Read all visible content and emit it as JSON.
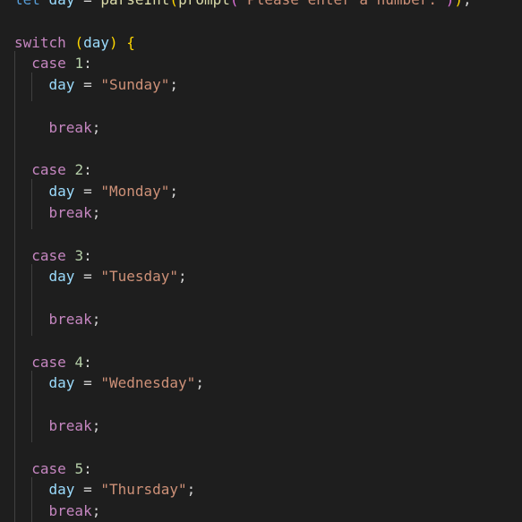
{
  "editor": {
    "lines": [
      {
        "tokens": [
          [
            "kw2",
            "let"
          ],
          [
            "pun",
            " "
          ],
          [
            "id",
            "day"
          ],
          [
            "pun",
            " = "
          ],
          [
            "fn",
            "parseInt"
          ],
          [
            "br1",
            "("
          ],
          [
            "fn",
            "prompt"
          ],
          [
            "br2",
            "("
          ],
          [
            "str",
            "\"Please enter a number:\""
          ],
          [
            "br2",
            ")"
          ],
          [
            "br1",
            ")"
          ],
          [
            "pun",
            ";"
          ]
        ]
      },
      {
        "tokens": []
      },
      {
        "tokens": [
          [
            "kw",
            "switch"
          ],
          [
            "pun",
            " "
          ],
          [
            "br1",
            "("
          ],
          [
            "id",
            "day"
          ],
          [
            "br1",
            ")"
          ],
          [
            "pun",
            " "
          ],
          [
            "br1",
            "{"
          ]
        ]
      },
      {
        "tokens": [
          [
            "pun",
            "  "
          ],
          [
            "kw",
            "case"
          ],
          [
            "pun",
            " "
          ],
          [
            "num",
            "1"
          ],
          [
            "pun",
            ":"
          ]
        ]
      },
      {
        "tokens": [
          [
            "pun",
            "    "
          ],
          [
            "id",
            "day"
          ],
          [
            "pun",
            " = "
          ],
          [
            "str",
            "\"Sunday\""
          ],
          [
            "pun",
            ";"
          ]
        ]
      },
      {
        "tokens": []
      },
      {
        "tokens": [
          [
            "pun",
            "    "
          ],
          [
            "kw",
            "break"
          ],
          [
            "pun",
            ";"
          ]
        ]
      },
      {
        "tokens": []
      },
      {
        "tokens": [
          [
            "pun",
            "  "
          ],
          [
            "kw",
            "case"
          ],
          [
            "pun",
            " "
          ],
          [
            "num",
            "2"
          ],
          [
            "pun",
            ":"
          ]
        ]
      },
      {
        "tokens": [
          [
            "pun",
            "    "
          ],
          [
            "id",
            "day"
          ],
          [
            "pun",
            " = "
          ],
          [
            "str",
            "\"Monday\""
          ],
          [
            "pun",
            ";"
          ]
        ]
      },
      {
        "tokens": [
          [
            "pun",
            "    "
          ],
          [
            "kw",
            "break"
          ],
          [
            "pun",
            ";"
          ]
        ]
      },
      {
        "tokens": []
      },
      {
        "tokens": [
          [
            "pun",
            "  "
          ],
          [
            "kw",
            "case"
          ],
          [
            "pun",
            " "
          ],
          [
            "num",
            "3"
          ],
          [
            "pun",
            ":"
          ]
        ]
      },
      {
        "tokens": [
          [
            "pun",
            "    "
          ],
          [
            "id",
            "day"
          ],
          [
            "pun",
            " = "
          ],
          [
            "str",
            "\"Tuesday\""
          ],
          [
            "pun",
            ";"
          ]
        ]
      },
      {
        "tokens": []
      },
      {
        "tokens": [
          [
            "pun",
            "    "
          ],
          [
            "kw",
            "break"
          ],
          [
            "pun",
            ";"
          ]
        ]
      },
      {
        "tokens": []
      },
      {
        "tokens": [
          [
            "pun",
            "  "
          ],
          [
            "kw",
            "case"
          ],
          [
            "pun",
            " "
          ],
          [
            "num",
            "4"
          ],
          [
            "pun",
            ":"
          ]
        ]
      },
      {
        "tokens": [
          [
            "pun",
            "    "
          ],
          [
            "id",
            "day"
          ],
          [
            "pun",
            " = "
          ],
          [
            "str",
            "\"Wednesday\""
          ],
          [
            "pun",
            ";"
          ]
        ]
      },
      {
        "tokens": []
      },
      {
        "tokens": [
          [
            "pun",
            "    "
          ],
          [
            "kw",
            "break"
          ],
          [
            "pun",
            ";"
          ]
        ]
      },
      {
        "tokens": []
      },
      {
        "tokens": [
          [
            "pun",
            "  "
          ],
          [
            "kw",
            "case"
          ],
          [
            "pun",
            " "
          ],
          [
            "num",
            "5"
          ],
          [
            "pun",
            ":"
          ]
        ]
      },
      {
        "tokens": [
          [
            "pun",
            "    "
          ],
          [
            "id",
            "day"
          ],
          [
            "pun",
            " = "
          ],
          [
            "str",
            "\"Thursday\""
          ],
          [
            "pun",
            ";"
          ]
        ]
      },
      {
        "tokens": [
          [
            "pun",
            "    "
          ],
          [
            "kw",
            "break"
          ],
          [
            "pun",
            ";"
          ]
        ]
      }
    ]
  },
  "colors": {
    "background": "#1e1e1e",
    "keyword": "#c586c0",
    "identifier": "#9cdcfe",
    "string": "#ce9178",
    "number": "#b5cea8",
    "function": "#dcdcaa",
    "bracket": "#ffd700"
  }
}
